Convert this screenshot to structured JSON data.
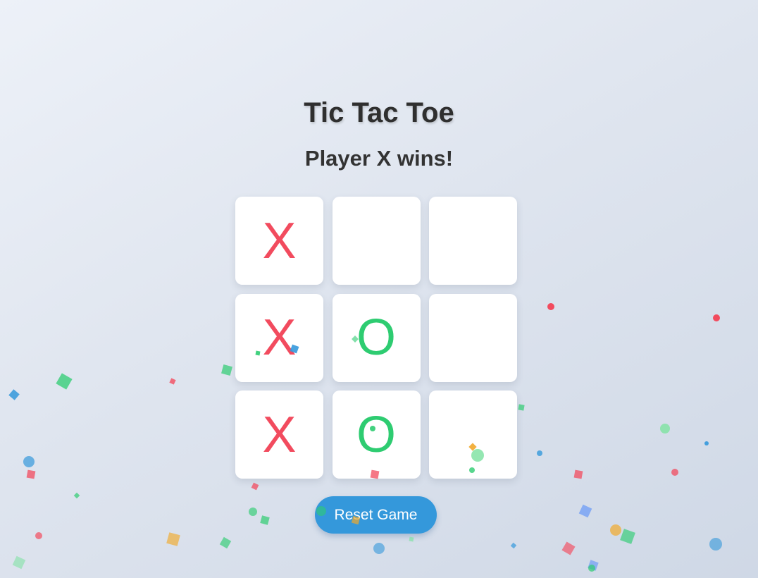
{
  "game": {
    "title": "Tic Tac Toe",
    "status": "Player X wins!",
    "board": [
      "X",
      "",
      "",
      "X",
      "O",
      "",
      "X",
      "O",
      ""
    ],
    "reset_label": "Reset Game"
  },
  "colors": {
    "x_mark": "#f24b5e",
    "o_mark": "#2ecc71",
    "button": "#3498db",
    "confetti": [
      "#f24b5e",
      "#2ecc71",
      "#3498db",
      "#f1a92b",
      "#6d9cf5",
      "#82e3a5"
    ]
  }
}
